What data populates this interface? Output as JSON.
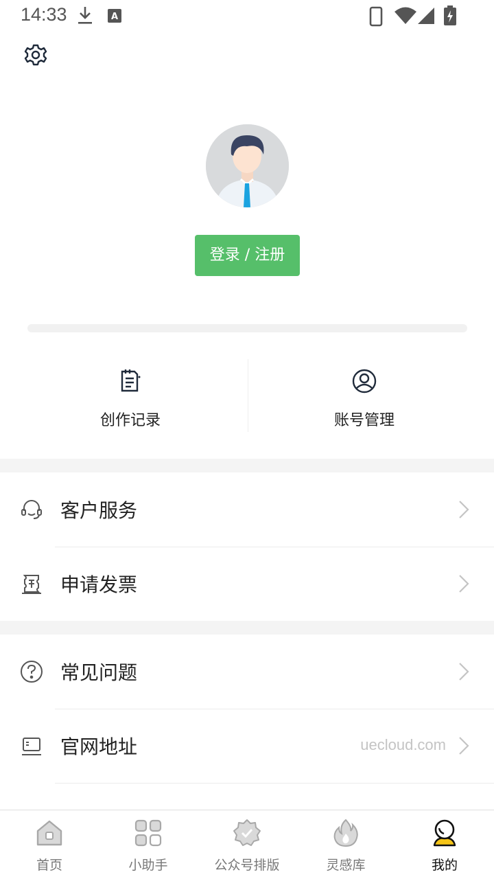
{
  "status_bar": {
    "time": "14:33"
  },
  "profile": {
    "login_label": "登录 / 注册"
  },
  "quick_actions": [
    {
      "label": "创作记录",
      "icon": "document-list-icon"
    },
    {
      "label": "账号管理",
      "icon": "user-circle-icon"
    }
  ],
  "menu": [
    {
      "label": "客户服务",
      "icon": "headset-icon",
      "value": ""
    },
    {
      "label": "申请发票",
      "icon": "invoice-icon",
      "value": ""
    },
    {
      "label": "常见问题",
      "icon": "question-circle-icon",
      "value": ""
    },
    {
      "label": "官网地址",
      "icon": "monitor-icon",
      "value": "uecloud.com"
    }
  ],
  "tabbar": [
    {
      "label": "首页",
      "icon": "home-icon",
      "active": false
    },
    {
      "label": "小助手",
      "icon": "grid-icon",
      "active": false
    },
    {
      "label": "公众号排版",
      "icon": "badge-check-icon",
      "active": false
    },
    {
      "label": "灵感库",
      "icon": "flame-icon",
      "active": false
    },
    {
      "label": "我的",
      "icon": "profile-icon",
      "active": true
    }
  ],
  "colors": {
    "accent_green": "#56bf6a",
    "active_yellow": "#f5c518",
    "icon_dark": "#1f2a3a"
  }
}
